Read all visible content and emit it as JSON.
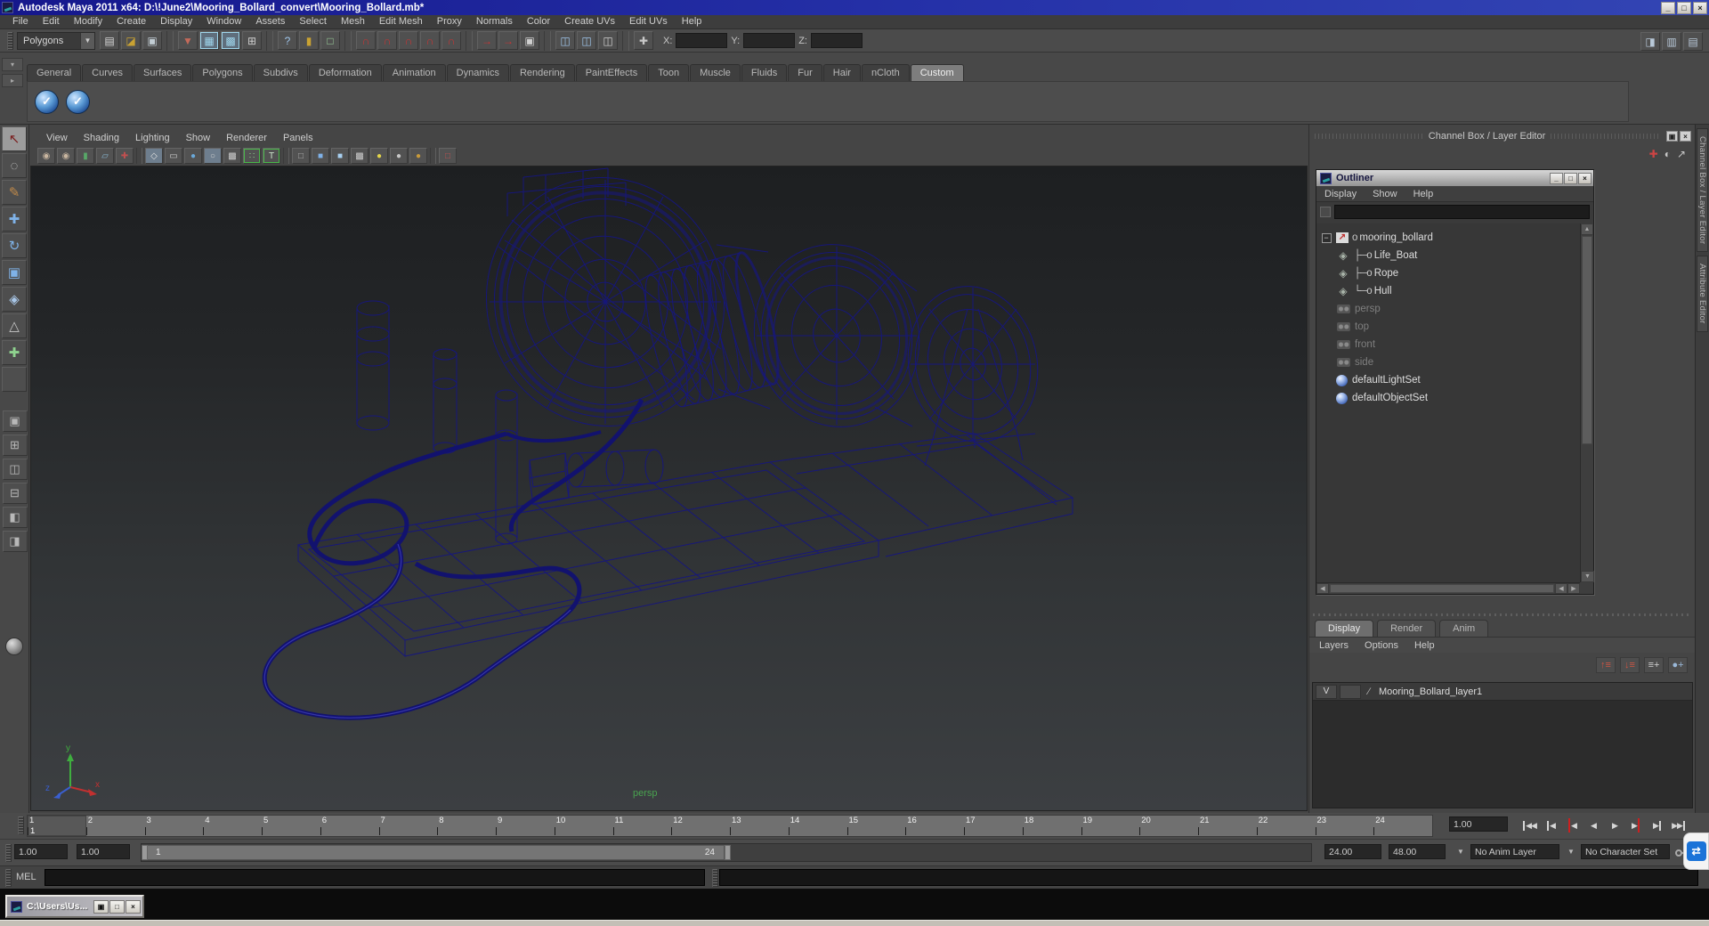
{
  "window": {
    "title": "Autodesk Maya 2011 x64: D:\\!June2\\Mooring_Bollard_convert\\Mooring_Bollard.mb*",
    "controls": [
      {
        "name": "minimize-button",
        "glyph": "_"
      },
      {
        "name": "maximize-button",
        "glyph": "□"
      },
      {
        "name": "close-button",
        "glyph": "×"
      }
    ]
  },
  "menu_bar": {
    "items": [
      "File",
      "Edit",
      "Modify",
      "Create",
      "Display",
      "Window",
      "Assets",
      "Select",
      "Mesh",
      "Edit Mesh",
      "Proxy",
      "Normals",
      "Color",
      "Create UVs",
      "Edit UVs",
      "Help"
    ]
  },
  "status_line": {
    "selector_label": "Polygons",
    "x_label": "X:",
    "y_label": "Y:",
    "z_label": "Z:",
    "groups": [
      {
        "name": "file-group",
        "icons": [
          {
            "name": "new-scene-icon",
            "glyph": "▤",
            "color": "#d9d9d9"
          },
          {
            "name": "open-scene-icon",
            "glyph": "◪",
            "color": "#c9a232"
          },
          {
            "name": "save-scene-icon",
            "glyph": "▣",
            "color": "#c2cdd4"
          }
        ]
      },
      {
        "name": "selection-group",
        "icons": [
          {
            "name": "select-by-hierarchy-icon",
            "glyph": "▼",
            "color": "#c46a5a"
          },
          {
            "name": "select-by-object-icon",
            "glyph": "▦",
            "color": "#9fd6ec",
            "selected": true
          },
          {
            "name": "select-by-component-icon",
            "glyph": "▩",
            "color": "#9fd6ec",
            "selected": true
          },
          {
            "name": "highlight-selection-icon",
            "glyph": "⊞",
            "color": "#cfcfcf"
          }
        ]
      },
      {
        "name": "tool-group",
        "icons": [
          {
            "name": "help-icon",
            "glyph": "?",
            "color": "#9fc6ec"
          },
          {
            "name": "lock-selection-icon",
            "glyph": "▮",
            "color": "#c9a232"
          },
          {
            "name": "selection-mask-icon",
            "glyph": "□",
            "color": "#9fd69f"
          }
        ]
      },
      {
        "name": "snap-group",
        "icons": [
          {
            "name": "snap-to-grids-icon",
            "glyph": "∩",
            "color": "#cc3333"
          },
          {
            "name": "snap-to-curves-icon",
            "glyph": "∩",
            "color": "#cc3333"
          },
          {
            "name": "snap-to-points-icon",
            "glyph": "∩",
            "color": "#cc3333"
          },
          {
            "name": "snap-to-planes-icon",
            "glyph": "∩",
            "color": "#cc3333"
          },
          {
            "name": "make-live-icon",
            "glyph": "∩",
            "color": "#cc3333"
          }
        ]
      },
      {
        "name": "history-group",
        "icons": [
          {
            "name": "input-connections-icon",
            "glyph": "→",
            "color": "#cc3333"
          },
          {
            "name": "output-connections-icon",
            "glyph": "→",
            "color": "#cc3333"
          },
          {
            "name": "construction-history-icon",
            "glyph": "▣",
            "color": "#cfcfcf"
          }
        ]
      },
      {
        "name": "render-group",
        "icons": [
          {
            "name": "render-current-frame-icon",
            "glyph": "◫",
            "color": "#9fc6ec"
          },
          {
            "name": "ipr-render-icon",
            "glyph": "◫",
            "color": "#9fc6ec"
          },
          {
            "name": "render-settings-icon",
            "glyph": "◫",
            "color": "#cfcfcf"
          }
        ]
      },
      {
        "name": "axis-group",
        "icons": [
          {
            "name": "world-axis-icon",
            "glyph": "✚",
            "color": "#c8c8c8"
          }
        ]
      }
    ],
    "right_icons": [
      {
        "name": "toggle-ui-elements-icon",
        "glyph": "◨",
        "color": "#b8c8d8"
      },
      {
        "name": "toggle-panel-layout-icon",
        "glyph": "▥",
        "color": "#b8c8d8"
      },
      {
        "name": "toggle-attribute-editor-icon",
        "glyph": "▤",
        "color": "#b8c8d8"
      }
    ]
  },
  "shelf": {
    "tabs": [
      "General",
      "Curves",
      "Surfaces",
      "Polygons",
      "Subdivs",
      "Deformation",
      "Animation",
      "Dynamics",
      "Rendering",
      "PaintEffects",
      "Toon",
      "Muscle",
      "Fluids",
      "Fur",
      "Hair",
      "nCloth",
      "Custom"
    ],
    "active_tab": "Custom",
    "buttons": [
      {
        "name": "custom-shelf-button-1",
        "glyph": "✓"
      },
      {
        "name": "custom-shelf-button-2",
        "glyph": "✓"
      }
    ]
  },
  "toolbox": {
    "tools": [
      {
        "name": "select-tool",
        "glyph": "↖",
        "color": "#7a1d1d",
        "active": true
      },
      {
        "name": "lasso-select-tool",
        "glyph": "◌",
        "color": "#cccccc"
      },
      {
        "name": "paint-select-tool",
        "glyph": "✎",
        "color": "#c08a4a"
      },
      {
        "name": "move-tool",
        "glyph": "✚",
        "color": "#7fb2e8"
      },
      {
        "name": "rotate-tool",
        "glyph": "↻",
        "color": "#7fb2e8"
      },
      {
        "name": "scale-tool",
        "glyph": "▣",
        "color": "#7fb2e8"
      },
      {
        "name": "universal-manipulator-tool",
        "glyph": "◈",
        "color": "#a9c7e8"
      },
      {
        "name": "soft-modification-tool",
        "glyph": "△",
        "color": "#c8c8c8"
      },
      {
        "name": "show-manipulator-tool",
        "glyph": "✚",
        "color": "#8fd28f"
      },
      {
        "name": "last-tool",
        "glyph": "",
        "color": "#888888"
      }
    ],
    "layout_buttons": [
      {
        "name": "layout-single-perspective",
        "glyph": "▣"
      },
      {
        "name": "layout-four-view",
        "glyph": "⊞"
      },
      {
        "name": "layout-persp-outliner",
        "glyph": "◫"
      },
      {
        "name": "layout-persp-graph",
        "glyph": "⊟"
      },
      {
        "name": "layout-hypershade-persp",
        "glyph": "◧"
      },
      {
        "name": "layout-persp-side",
        "glyph": "◨"
      }
    ]
  },
  "viewport": {
    "menus": [
      "View",
      "Shading",
      "Lighting",
      "Show",
      "Renderer",
      "Panels"
    ],
    "toolbar_icons": [
      {
        "name": "camera-select-icon",
        "glyph": "◉",
        "color": "#c9b6a0"
      },
      {
        "name": "camera-attributes-icon",
        "glyph": "◉",
        "color": "#c9b6a0"
      },
      {
        "name": "bookmarks-icon",
        "glyph": "▮",
        "color": "#58a868"
      },
      {
        "name": "image-plane-icon",
        "glyph": "▱",
        "color": "#88b6d0"
      },
      {
        "name": "2d-pan-zoom-icon",
        "glyph": "✚",
        "color": "#c05050"
      },
      {
        "divider": true
      },
      {
        "name": "wireframe-display-icon",
        "glyph": "◇",
        "color": "#e0e0e0",
        "selected": true
      },
      {
        "name": "film-gate-icon",
        "glyph": "▭",
        "color": "#cfcfcf"
      },
      {
        "name": "resolution-gate-icon",
        "glyph": "●",
        "color": "#6aa8d8"
      },
      {
        "name": "gate-mask-icon",
        "glyph": "○",
        "color": "#cfcfcf",
        "selected": true
      },
      {
        "name": "field-chart-icon",
        "glyph": "▩",
        "color": "#cfcfcf"
      },
      {
        "name": "safe-action-icon",
        "glyph": "∷",
        "color": "#8fd28f",
        "green_border": true
      },
      {
        "name": "safe-title-icon",
        "glyph": "T",
        "color": "#cfe8cf",
        "green_border": true
      },
      {
        "divider": true
      },
      {
        "name": "isolate-select-icon",
        "glyph": "□",
        "color": "#b0b0b0"
      },
      {
        "name": "shaded-display-icon",
        "glyph": "■",
        "color": "#7fb2e8"
      },
      {
        "name": "textured-display-icon",
        "glyph": "■",
        "color": "#a8d0f0"
      },
      {
        "name": "use-default-material-icon",
        "glyph": "▩",
        "color": "#d0d0d0"
      },
      {
        "name": "lighting-all-icon",
        "glyph": "●",
        "color": "#e2d44a"
      },
      {
        "name": "lighting-default-icon",
        "glyph": "●",
        "color": "#c8c8c8"
      },
      {
        "name": "lighting-selected-icon",
        "glyph": "●",
        "color": "#c89a3a"
      },
      {
        "divider": true
      },
      {
        "name": "object-selection-icon",
        "glyph": "□",
        "color": "#c05050"
      }
    ],
    "camera_label": "persp",
    "axis_labels": {
      "x": "x",
      "y": "y",
      "z": "z"
    }
  },
  "outliner": {
    "title": "Outliner",
    "menus": [
      "Display",
      "Show",
      "Help"
    ],
    "icon_glyphs": {
      "transform": "↗",
      "mesh": "◈",
      "camera": "",
      "set": ""
    },
    "items": [
      {
        "label": "mooring_bollard",
        "icon": "transform",
        "prefix": "o",
        "expander": true,
        "dim": false
      },
      {
        "label": "Life_Boat",
        "icon": "mesh",
        "prefix": "├─o",
        "dim": false
      },
      {
        "label": "Rope",
        "icon": "mesh",
        "prefix": "├─o",
        "dim": false
      },
      {
        "label": "Hull",
        "icon": "mesh",
        "prefix": "└─o",
        "dim": false
      },
      {
        "label": "persp",
        "icon": "camera",
        "prefix": "",
        "dim": true
      },
      {
        "label": "top",
        "icon": "camera",
        "prefix": "",
        "dim": true
      },
      {
        "label": "front",
        "icon": "camera",
        "prefix": "",
        "dim": true
      },
      {
        "label": "side",
        "icon": "camera",
        "prefix": "",
        "dim": true
      },
      {
        "label": "defaultLightSet",
        "icon": "set",
        "prefix": "",
        "dim": false
      },
      {
        "label": "defaultObjectSet",
        "icon": "set",
        "prefix": "",
        "dim": false
      }
    ]
  },
  "channel_box": {
    "header": "Channel Box / Layer Editor",
    "header_icons": [
      {
        "name": "show-axis-icon",
        "glyph": "✚",
        "color": "#cc4444"
      },
      {
        "name": "display-toggle-icon",
        "glyph": "◐",
        "color": "#c8c8c8"
      },
      {
        "name": "pop-out-icon",
        "glyph": "↗",
        "color": "#c8c8c8"
      }
    ]
  },
  "right_tabs": [
    {
      "name": "tab-channel-box-layer-editor",
      "label": "Channel Box / Layer Editor"
    },
    {
      "name": "tab-attribute-editor",
      "label": "Attribute Editor"
    }
  ],
  "layer_editor": {
    "tabs": [
      "Display",
      "Render",
      "Anim"
    ],
    "active_tab": "Display",
    "menus": [
      "Layers",
      "Options",
      "Help"
    ],
    "icons": [
      {
        "name": "move-layer-up-icon",
        "glyph": "↑≡",
        "color": "#cc5544"
      },
      {
        "name": "move-layer-down-icon",
        "glyph": "↓≡",
        "color": "#cc5544"
      },
      {
        "name": "new-empty-layer-icon",
        "glyph": "≡+",
        "color": "#d0d0d0"
      },
      {
        "name": "new-layer-from-selected-icon",
        "glyph": "●+",
        "color": "#9ab8d8"
      }
    ],
    "layers": [
      {
        "visibility": "V",
        "type_glyph": "∕",
        "name": "Mooring_Bollard_layer1"
      }
    ]
  },
  "time_slider": {
    "frames": [
      "1",
      "2",
      "3",
      "4",
      "5",
      "6",
      "7",
      "8",
      "9",
      "10",
      "11",
      "12",
      "13",
      "14",
      "15",
      "16",
      "17",
      "18",
      "19",
      "20",
      "21",
      "22",
      "23",
      "24"
    ],
    "current_frame": "1",
    "speed_field": "1.00",
    "transport": [
      {
        "name": "go-to-start-button",
        "glyph": "◀◀",
        "bar": "before"
      },
      {
        "name": "step-back-frame-button",
        "glyph": "◀",
        "bar": "before"
      },
      {
        "name": "step-back-key-button",
        "glyph": "◀",
        "bar": "before",
        "red": true
      },
      {
        "name": "play-backwards-button",
        "glyph": "◀"
      },
      {
        "name": "play-forwards-button",
        "glyph": "▶"
      },
      {
        "name": "step-forward-key-button",
        "glyph": "▶",
        "bar": "after",
        "red": true
      },
      {
        "name": "step-forward-frame-button",
        "glyph": "▶",
        "bar": "after"
      },
      {
        "name": "go-to-end-button",
        "glyph": "▶▶",
        "bar": "after"
      }
    ]
  },
  "range_slider": {
    "animation_start": "1.00",
    "playback_start": "1.00",
    "bar_start": "1",
    "bar_end": "24",
    "playback_end": "24.00",
    "animation_end": "48.00",
    "anim_layer": "No Anim Layer",
    "character_set": "No Character Set"
  },
  "command_line": {
    "label": "MEL"
  },
  "taskbar": {
    "window_title": "C:\\Users\\Us...",
    "buttons": [
      {
        "name": "restore-button",
        "glyph": "▣"
      },
      {
        "name": "maximize-button",
        "glyph": "□"
      },
      {
        "name": "close-button",
        "glyph": "×"
      }
    ]
  },
  "overlay": {
    "teamviewer_icon": "⇄"
  }
}
